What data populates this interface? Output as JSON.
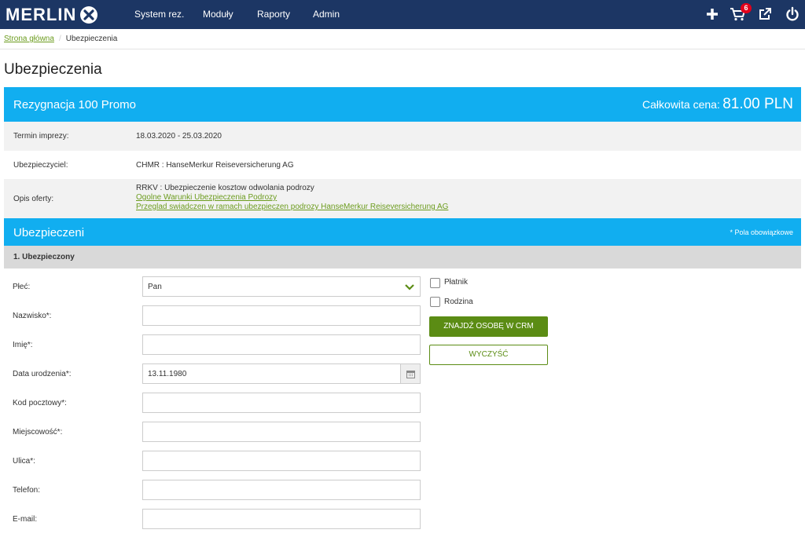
{
  "brand": {
    "name": "MERLIN"
  },
  "nav": {
    "items": [
      "System rez.",
      "Moduły",
      "Raporty",
      "Admin"
    ],
    "cart_count": "6"
  },
  "breadcrumb": {
    "home": "Strona główna",
    "current": "Ubezpieczenia"
  },
  "page": {
    "title": "Ubezpieczenia"
  },
  "offer": {
    "name": "Rezygnacja 100 Promo",
    "total_label": "Całkowita cena:",
    "total_value": "81.00 PLN",
    "rows": {
      "term_label": "Termin imprezy:",
      "term_value": "18.03.2020 - 25.03.2020",
      "insurer_label": "Ubezpieczyciel:",
      "insurer_value": "CHMR : HanseMerkur Reiseversicherung AG",
      "desc_label": "Opis oferty:",
      "desc_text": "RRKV : Ubezpieczenie kosztow odwolania podrozy",
      "desc_link1": "Ogolne Warunki Ubezpieczenia Podrozy",
      "desc_link2": "Przeglad swiadczen w ramach ubezpieczen podrozy HanseMerkur Reiseversicherung AG"
    }
  },
  "insured": {
    "title": "Ubezpieczeni",
    "required_note": "* Pola obowiązkowe",
    "person_title": "1. Ubezpieczony",
    "fields": {
      "gender_label": "Płeć:",
      "gender_value": "Pan",
      "surname_label": "Nazwisko*:",
      "surname_value": "",
      "firstname_label": "Imię*:",
      "firstname_value": "",
      "dob_label": "Data urodzenia*:",
      "dob_value": "13.11.1980",
      "postal_label": "Kod pocztowy*:",
      "postal_value": "",
      "city_label": "Miejscowość*:",
      "city_value": "",
      "street_label": "Ulica*:",
      "street_value": "",
      "phone_label": "Telefon:",
      "phone_value": "",
      "email_label": "E-mail:",
      "email_value": ""
    },
    "checkboxes": {
      "payer": "Płatnik",
      "family": "Rodzina"
    },
    "buttons": {
      "find_crm": "ZNAJDŹ OSOBĘ W CRM",
      "clear": "WYCZYŚĆ"
    }
  },
  "colors": {
    "navbar": "#1c3664",
    "accent_blue": "#11aef0",
    "green": "#5b8c14",
    "badge": "#e3001b"
  },
  "icons": [
    "merlin-x-logo-icon",
    "plus-icon",
    "cart-icon",
    "external-link-icon",
    "power-icon",
    "chevron-down-icon",
    "calendar-icon"
  ]
}
